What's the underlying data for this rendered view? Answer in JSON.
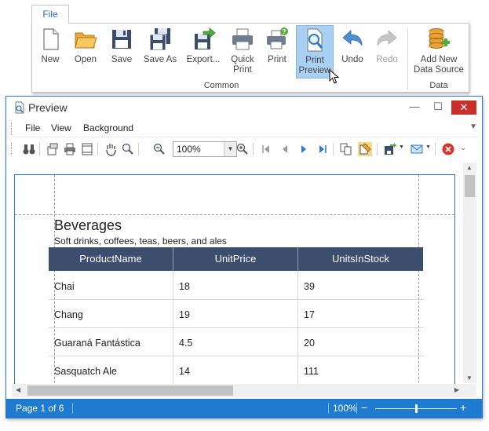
{
  "ribbon": {
    "tab_label": "File",
    "buttons": [
      {
        "label": "New"
      },
      {
        "label": "Open"
      },
      {
        "label": "Save"
      },
      {
        "label": "Save As"
      },
      {
        "label": "Export..."
      },
      {
        "label": "Quick Print"
      },
      {
        "label": "Print"
      },
      {
        "label": "Print Preview"
      },
      {
        "label": "Undo"
      },
      {
        "label": "Redo"
      },
      {
        "label": "Add New Data Source"
      }
    ],
    "groups": [
      {
        "label": "Common"
      },
      {
        "label": "Data"
      }
    ]
  },
  "window": {
    "title": "Preview",
    "minimize": "—",
    "maximize": "☐",
    "close": "✕"
  },
  "menu": {
    "items": [
      {
        "label": "File"
      },
      {
        "label": "View"
      },
      {
        "label": "Background"
      }
    ]
  },
  "toolbar": {
    "zoom_value": "100%"
  },
  "report": {
    "title": "Beverages",
    "subtitle": "Soft drinks, coffees, teas, beers, and ales",
    "columns": [
      "ProductName",
      "UnitPrice",
      "UnitsInStock"
    ],
    "rows": [
      [
        "Chai",
        "18",
        "39"
      ],
      [
        "Chang",
        "19",
        "17"
      ],
      [
        "Guaraná Fantástica",
        "4.5",
        "20"
      ],
      [
        "Sasquatch Ale",
        "14",
        "111"
      ]
    ]
  },
  "status": {
    "page": "Page 1 of 6",
    "zoom": "100%",
    "zoom_minus": "−",
    "zoom_plus": "+",
    "zoom_level_fraction": 0.5
  },
  "colors": {
    "accent": "#1e7bd0",
    "header_bg": "#3d4d6e",
    "close_red": "#c9302c",
    "active_button": "#a9d0f3"
  }
}
